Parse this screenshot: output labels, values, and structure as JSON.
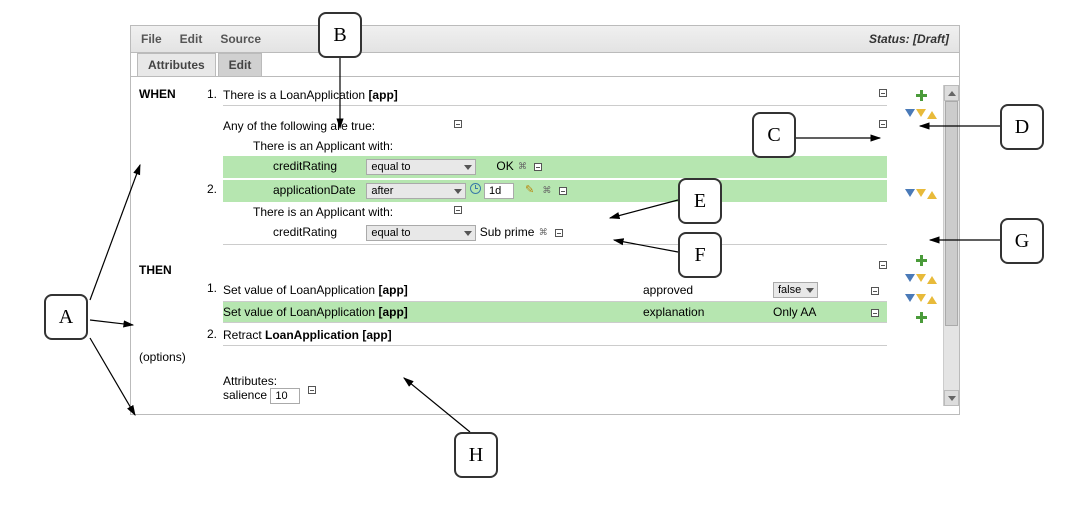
{
  "menu": {
    "file": "File",
    "edit": "Edit",
    "source": "Source"
  },
  "status_label": "Status: [Draft]",
  "tabs": {
    "attributes": "Attributes",
    "edit": "Edit"
  },
  "sections": {
    "when": "WHEN",
    "then": "THEN",
    "options": "(options)"
  },
  "when": {
    "n1": "1.",
    "n2": "2.",
    "line1_a": "There is a LoanApplication ",
    "line1_b": "[app]",
    "group_label": "Any of the following are true:",
    "appl1": "There is an Applicant with:",
    "cr_label": "creditRating",
    "cr_op": "equal to",
    "cr_val": "OK",
    "date_label": "applicationDate",
    "date_op": "after",
    "date_val": "1d",
    "appl2": "There is an Applicant with:",
    "cr2_label": "creditRating",
    "cr2_op": "equal to",
    "cr2_val": "Sub prime"
  },
  "then": {
    "n1": "1.",
    "n2": "2.",
    "set1_a": "Set value of LoanApplication ",
    "set1_b": "[app]",
    "set1_field": "approved",
    "set1_value": "false",
    "set2_a": "Set value of LoanApplication ",
    "set2_b": "[app]",
    "set2_field": "explanation",
    "set2_value": "Only AA",
    "retract_a": "Retract ",
    "retract_b": "LoanApplication [app]"
  },
  "attrs": {
    "heading": "Attributes:",
    "salience_label": "salience",
    "salience_value": "10"
  },
  "callouts": {
    "A": "A",
    "B": "B",
    "C": "C",
    "D": "D",
    "E": "E",
    "F": "F",
    "G": "G",
    "H": "H"
  }
}
